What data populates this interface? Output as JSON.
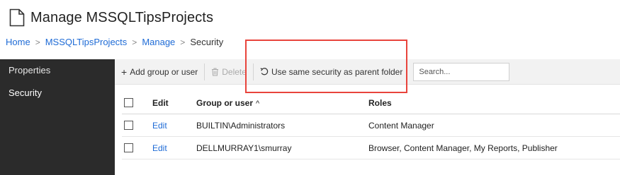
{
  "header": {
    "title": "Manage MSSQLTipsProjects",
    "title_icon": "document-icon"
  },
  "breadcrumb": {
    "items": [
      {
        "label": "Home",
        "link": true
      },
      {
        "label": "MSSQLTipsProjects",
        "link": true
      },
      {
        "label": "Manage",
        "link": true
      },
      {
        "label": "Security",
        "link": false
      }
    ],
    "separator": ">"
  },
  "sidebar": {
    "items": [
      {
        "label": "Properties",
        "active": false
      },
      {
        "label": "Security",
        "active": true
      }
    ]
  },
  "toolbar": {
    "add_label": "Add group or user",
    "add_icon": "plus-icon",
    "delete_label": "Delete",
    "delete_icon": "trash-icon",
    "delete_disabled": true,
    "inherit_label": "Use same security as parent folder",
    "inherit_icon": "undo-icon",
    "search_placeholder": "Search..."
  },
  "table": {
    "columns": {
      "edit": "Edit",
      "group": "Group or user",
      "roles": "Roles",
      "sort_indicator": "^"
    },
    "rows": [
      {
        "edit": "Edit",
        "group": "BUILTIN\\Administrators",
        "roles": "Content Manager"
      },
      {
        "edit": "Edit",
        "group": "DELLMURRAY1\\smurray",
        "roles": "Browser, Content Manager, My Reports, Publisher"
      }
    ]
  },
  "colors": {
    "link": "#1e6bd6",
    "sidebar_bg": "#2b2b2b",
    "toolbar_bg": "#f2f2f2",
    "highlight": "#e8443c"
  }
}
